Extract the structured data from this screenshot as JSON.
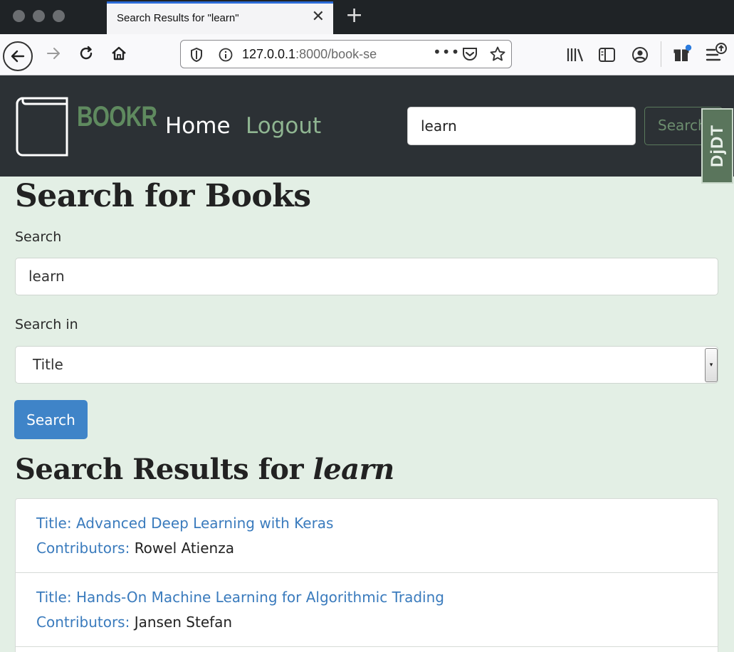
{
  "browser": {
    "tab_title": "Search Results for \"learn\"",
    "url_host": "127.0.0.1",
    "url_rest": ":8000/book-se"
  },
  "site": {
    "brand": "BOOKR",
    "nav": {
      "home": "Home",
      "logout": "Logout"
    },
    "header_search": {
      "value": "learn",
      "button": "Search"
    },
    "debug_toolbar": "DjDT"
  },
  "main": {
    "page_title": "Search for Books",
    "search_label": "Search",
    "search_value": "learn",
    "search_in_label": "Search in",
    "search_in_selected": "Title",
    "submit_label": "Search",
    "results_heading_prefix": "Search Results for ",
    "results_heading_term": "learn",
    "results": [
      {
        "title_label": "Title: ",
        "title": "Advanced Deep Learning with Keras",
        "contributors_label": "Contributors: ",
        "contributors": "Rowel Atienza"
      },
      {
        "title_label": "Title: ",
        "title": "Hands-On Machine Learning for Algorithmic Trading",
        "contributors_label": "Contributors: ",
        "contributors": "Jansen Stefan"
      }
    ]
  },
  "colors": {
    "page_bg": "#e3efe5",
    "header_bg": "#2c3135",
    "brand_green": "#5f8a5f",
    "link_blue": "#3a7bbd",
    "button_blue": "#3f84c8"
  }
}
